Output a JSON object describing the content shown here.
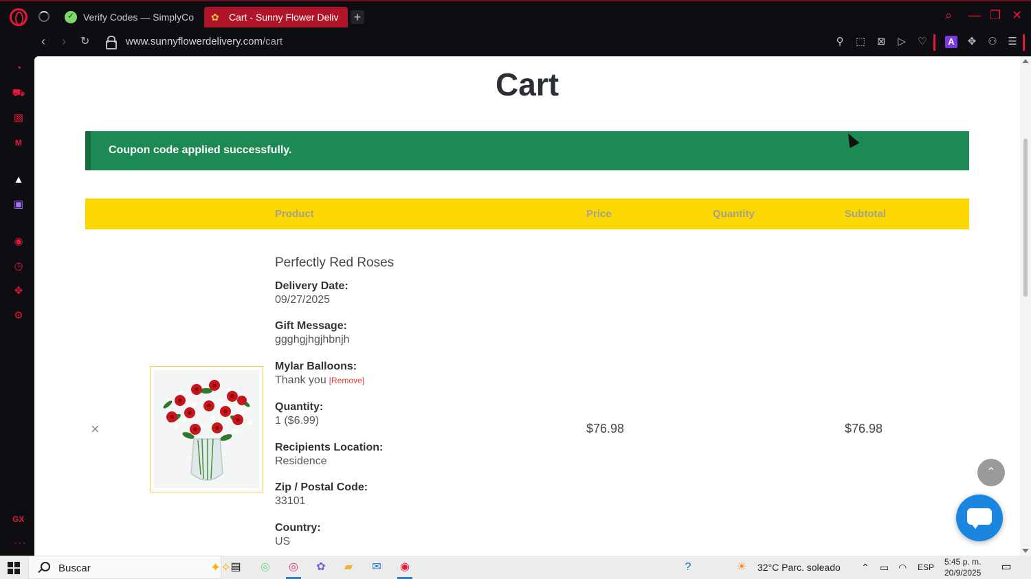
{
  "browser": {
    "tabs": [
      {
        "label": "Verify Codes — SimplyCo",
        "active": false
      },
      {
        "label": "Cart - Sunny Flower Deliv",
        "active": true
      }
    ],
    "url_domain": "www.sunnyflowerdelivery.com",
    "url_path": "/cart",
    "accent_color": "#e8173a"
  },
  "page": {
    "title": "Cart",
    "notice": "Coupon code applied successfully.",
    "table_headers": {
      "product": "Product",
      "price": "Price",
      "quantity": "Quantity",
      "subtotal": "Subtotal"
    },
    "item": {
      "remove_symbol": "×",
      "name": "Perfectly Red Roses",
      "details": [
        {
          "label": "Delivery Date:",
          "value": "09/27/2025"
        },
        {
          "label": "Gift Message:",
          "value": "ggghgjhgjhbnjh"
        },
        {
          "label": "Mylar Balloons:",
          "value": "Thank you",
          "action": "[Remove]"
        },
        {
          "label": "Quantity:",
          "value": "1 ($6.99)"
        },
        {
          "label": "Recipients Location:",
          "value": "Residence"
        },
        {
          "label": "Zip / Postal Code:",
          "value": "33101"
        },
        {
          "label": "Country:",
          "value": "US"
        }
      ],
      "price": "$76.98",
      "subtotal": "$76.98"
    }
  },
  "taskbar": {
    "search_placeholder": "Buscar",
    "weather": "32°C  Parc. soleado",
    "language": "ESP",
    "time": "5:45 p. m.",
    "date": "20/9/2025"
  }
}
